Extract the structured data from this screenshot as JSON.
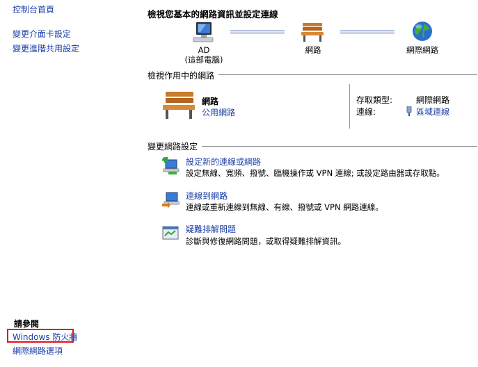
{
  "sidebar": {
    "home": "控制台首頁",
    "adapter_settings": "變更介面卡設定",
    "advanced_sharing": "變更進階共用設定",
    "see_also": "請參閱",
    "firewall": "Windows 防火牆",
    "internet_options": "網際網路選項"
  },
  "main": {
    "title": "檢視您基本的網路資訊並設定連線",
    "map": {
      "computer_name": "AD",
      "computer_sub": "(這部電腦)",
      "network": "網路",
      "internet": "網際網路"
    },
    "active_networks": {
      "heading": "檢視作用中的網路",
      "network_name": "網路",
      "network_type": "公用網路",
      "access_type_label": "存取類型:",
      "access_type_value": "網際網路",
      "connections_label": "連線:",
      "connections_value": "區域連線"
    },
    "change_settings": {
      "heading": "變更網路設定",
      "tasks": [
        {
          "title": "設定新的連線或網路",
          "desc": "設定無線、寬頻、撥號、臨機操作或 VPN 連線; 或設定路由器或存取點。"
        },
        {
          "title": "連線到網路",
          "desc": "連線或重新連線到無線、有線、撥號或 VPN 網路連線。"
        },
        {
          "title": "疑難排解問題",
          "desc": "診斷與修復網路問題，或取得疑難排解資訊。"
        }
      ]
    }
  },
  "colors": {
    "link": "#1a3fa6",
    "highlight_box": "#e8101a"
  }
}
